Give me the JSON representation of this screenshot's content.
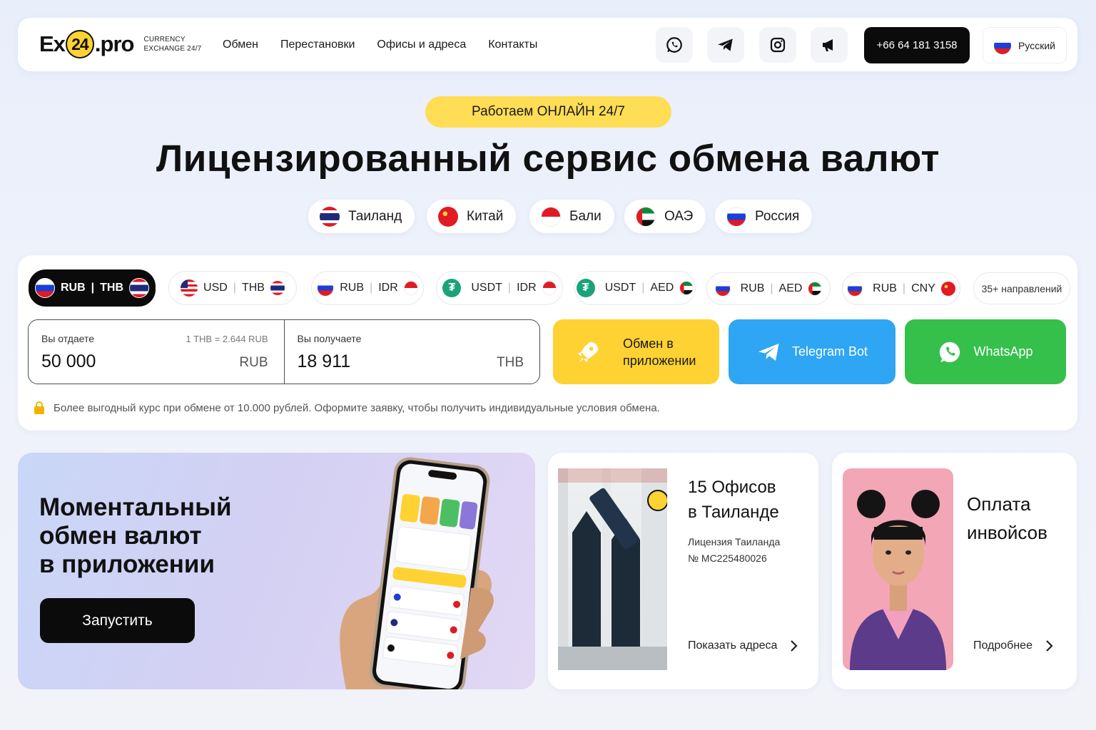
{
  "header": {
    "logo_left": "Ex",
    "logo_num": "24",
    "logo_right": ".pro",
    "logo_tag_1": "CURRENCY",
    "logo_tag_2": "EXCHANGE 24/7",
    "nav": [
      "Обмен",
      "Перестановки",
      "Офисы и адреса",
      "Контакты"
    ],
    "icons": [
      "whatsapp-icon",
      "telegram-icon",
      "instagram-icon",
      "megaphone-icon"
    ],
    "phone": "+66 64 181 3158",
    "language": "Русский"
  },
  "hero": {
    "badge": "Работаем ОНЛАЙН 24/7",
    "title": "Лицензированный сервис обмена валют",
    "countries": [
      "Таиланд",
      "Китай",
      "Бали",
      "ОАЭ",
      "Россия"
    ]
  },
  "converter": {
    "pairs": [
      {
        "from": "RUB",
        "to": "THB",
        "active": true
      },
      {
        "from": "USD",
        "to": "THB"
      },
      {
        "from": "RUB",
        "to": "IDR"
      },
      {
        "from": "USDT",
        "to": "IDR"
      },
      {
        "from": "USDT",
        "to": "AED"
      },
      {
        "from": "RUB",
        "to": "AED"
      },
      {
        "from": "RUB",
        "to": "CNY"
      }
    ],
    "more": "35+ направлений",
    "give_label": "Вы отдаете",
    "give_value": "50 000",
    "give_currency": "RUB",
    "rate": "1 THB = 2.644 RUB",
    "get_label": "Вы получаете",
    "get_value": "18 911",
    "get_currency": "THB",
    "app_button_1": "Обмен в",
    "app_button_2": "приложении",
    "telegram_button": "Telegram Bot",
    "whatsapp_button": "WhatsApp",
    "note": "Более выгодный курс при обмене от 10.000 рублей. Оформите заявку, чтобы получить индивидуальные условия обмена."
  },
  "colors": {
    "accent_yellow": "#ffd233",
    "telegram_blue": "#2ea6f4",
    "whatsapp_green": "#34c04a",
    "dark": "#0b0b0b"
  },
  "promo": {
    "app_title_1": "Моментальный",
    "app_title_2": "обмен валют",
    "app_title_3": "в приложении",
    "launch": "Запустить",
    "offices_title_1": "15 Офисов",
    "offices_title_2": "в Таиланде",
    "license_1": "Лицензия Таиланда",
    "license_2": "№ MC225480026",
    "offices_link": "Показать адреса",
    "invoice_title_1": "Оплата",
    "invoice_title_2": "инвойсов",
    "invoice_link": "Подробнее"
  }
}
